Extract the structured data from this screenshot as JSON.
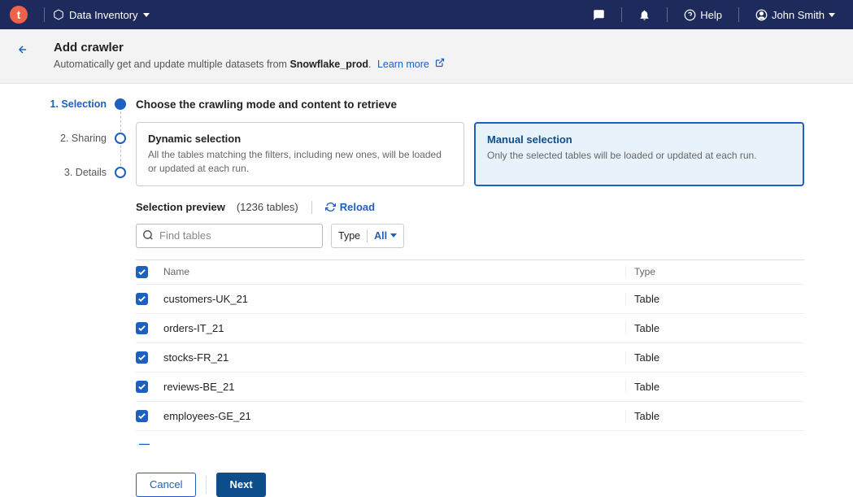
{
  "topbar": {
    "logo_letter": "t",
    "nav_label": "Data Inventory",
    "help_label": "Help",
    "user_name": "John Smith"
  },
  "header": {
    "title": "Add crawler",
    "subtitle_prefix": "Automatically get and update multiple datasets from ",
    "subtitle_source": "Snowflake_prod",
    "subtitle_suffix": ". ",
    "learn_more": "Learn more"
  },
  "steps": [
    {
      "label": "1. Selection",
      "active": true
    },
    {
      "label": "2. Sharing",
      "active": false
    },
    {
      "label": "3. Details",
      "active": false
    }
  ],
  "section_title": "Choose the crawling mode and content to retrieve",
  "cards": {
    "dynamic": {
      "title": "Dynamic selection",
      "desc": "All the tables matching the filters, including new ones, will be loaded or updated at each run."
    },
    "manual": {
      "title": "Manual selection",
      "desc": "Only the selected tables will be loaded or updated at each run."
    }
  },
  "preview": {
    "label": "Selection preview",
    "count_text": "(1236 tables)",
    "reload": "Reload"
  },
  "filters": {
    "search_placeholder": "Find tables",
    "type_label": "Type",
    "type_value": "All"
  },
  "table": {
    "col_name": "Name",
    "col_type": "Type",
    "rows": [
      {
        "name": "customers-UK_21",
        "type": "Table"
      },
      {
        "name": "orders-IT_21",
        "type": "Table"
      },
      {
        "name": "stocks-FR_21",
        "type": "Table"
      },
      {
        "name": "reviews-BE_21",
        "type": "Table"
      },
      {
        "name": "employees-GE_21",
        "type": "Table"
      }
    ]
  },
  "footer": {
    "cancel": "Cancel",
    "next": "Next"
  }
}
